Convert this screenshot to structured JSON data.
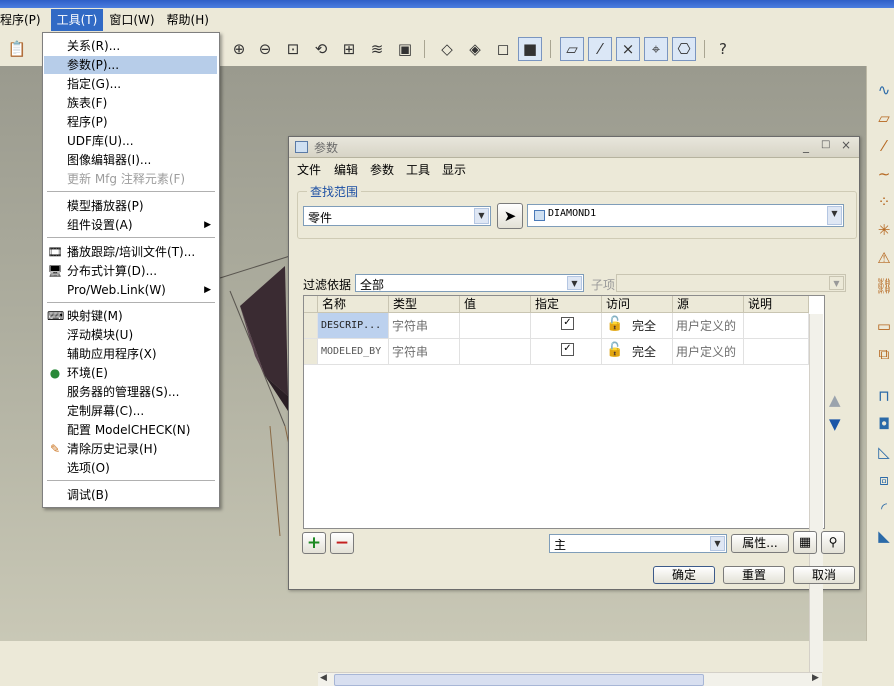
{
  "menubar": {
    "items": [
      "程序(P)",
      "工具(T)",
      "窗口(W)",
      "帮助(H)"
    ]
  },
  "tools_menu": {
    "items": [
      {
        "label": "关系(R)...",
        "icon": ""
      },
      {
        "label": "参数(P)...",
        "icon": ""
      },
      {
        "label": "指定(G)...",
        "icon": ""
      },
      {
        "label": "族表(F)",
        "icon": ""
      },
      {
        "label": "程序(P)",
        "icon": ""
      },
      {
        "label": "UDF库(U)...",
        "icon": ""
      },
      {
        "label": "图像编辑器(I)...",
        "icon": ""
      },
      {
        "label": "更新 Mfg 注释元素(F)",
        "icon": ""
      },
      {
        "label": "模型播放器(P)",
        "icon": ""
      },
      {
        "label": "组件设置(A)",
        "icon": ""
      },
      {
        "label": "播放跟踪/培训文件(T)...",
        "icon": "film-icon"
      },
      {
        "label": "分布式计算(D)...",
        "icon": "computer-icon"
      },
      {
        "label": "Pro/Web.Link(W)",
        "icon": ""
      },
      {
        "label": "映射键(M)",
        "icon": "keyboard-icon"
      },
      {
        "label": "浮动模块(U)",
        "icon": ""
      },
      {
        "label": "辅助应用程序(X)",
        "icon": ""
      },
      {
        "label": "环境(E)",
        "icon": "globe-icon"
      },
      {
        "label": "服务器的管理器(S)...",
        "icon": ""
      },
      {
        "label": "定制屏幕(C)...",
        "icon": ""
      },
      {
        "label": "配置 ModelCHECK(N)",
        "icon": ""
      },
      {
        "label": "清除历史记录(H)",
        "icon": "broom-icon"
      },
      {
        "label": "选项(O)",
        "icon": ""
      },
      {
        "label": "调试(B)",
        "icon": ""
      }
    ]
  },
  "dialog": {
    "title": "参数",
    "menu": [
      "文件",
      "编辑",
      "参数",
      "工具",
      "显示"
    ],
    "search_group_label": "查找范围",
    "scope_type": "零件",
    "scope_model": "DIAMOND1",
    "filter_label": "过滤依据",
    "filter_value": "全部",
    "subitem_label": "子项",
    "columns": [
      "名称",
      "类型",
      "值",
      "指定",
      "访问",
      "源",
      "说明"
    ],
    "rows": [
      {
        "name": "DESCRIP...",
        "type": "字符串",
        "value": "",
        "designate": true,
        "access": "完全",
        "source": "用户定义的",
        "desc": ""
      },
      {
        "name": "MODELED_BY",
        "type": "字符串",
        "value": "",
        "designate": true,
        "access": "完全",
        "source": "用户定义的",
        "desc": ""
      }
    ],
    "main_select": "主",
    "properties_button": "属性...",
    "ok": "确定",
    "reset": "重置",
    "cancel": "取消"
  },
  "colors": {
    "accent": "#316ac5",
    "menu_highlight": "#b7cde9",
    "selected_cell": "#bcd1ee"
  }
}
